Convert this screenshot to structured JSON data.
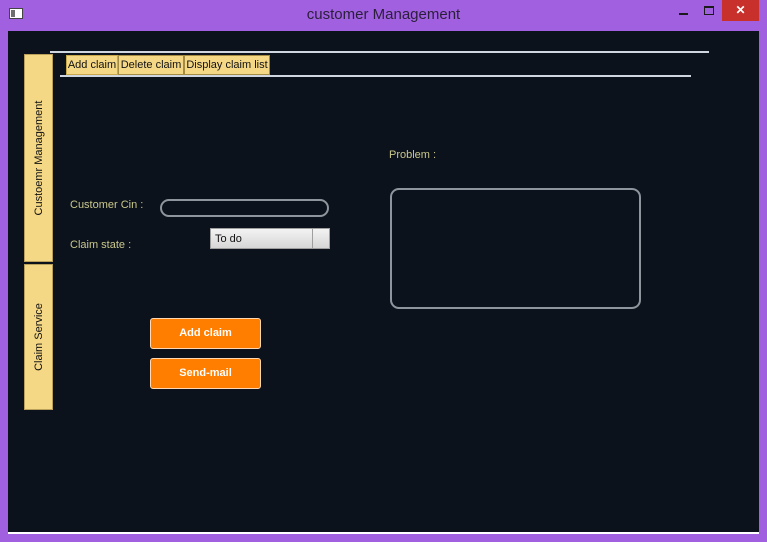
{
  "window": {
    "title": "customer Management",
    "close_glyph": "✕",
    "app_icon": "window-icon"
  },
  "side_tabs": [
    {
      "label": "Custoemr Management"
    },
    {
      "label": "Claim Service"
    }
  ],
  "tabs": [
    {
      "label": "Add claim",
      "active": true
    },
    {
      "label": "Delete claim"
    },
    {
      "label": "Display claim list"
    }
  ],
  "form": {
    "customer_cin_label": "Customer Cin :",
    "customer_cin_value": "",
    "claim_state_label": "Claim state :",
    "claim_state_value": "To do",
    "problem_label": "Problem :",
    "problem_value": ""
  },
  "buttons": {
    "add_claim": "Add claim",
    "send_mail": "Send-mail"
  },
  "colors": {
    "titlebar": "#a160e0",
    "background": "#0c121b",
    "tab": "#f5d886",
    "button": "#ff7e00",
    "label": "#c9c88d",
    "close": "#c7302b"
  }
}
